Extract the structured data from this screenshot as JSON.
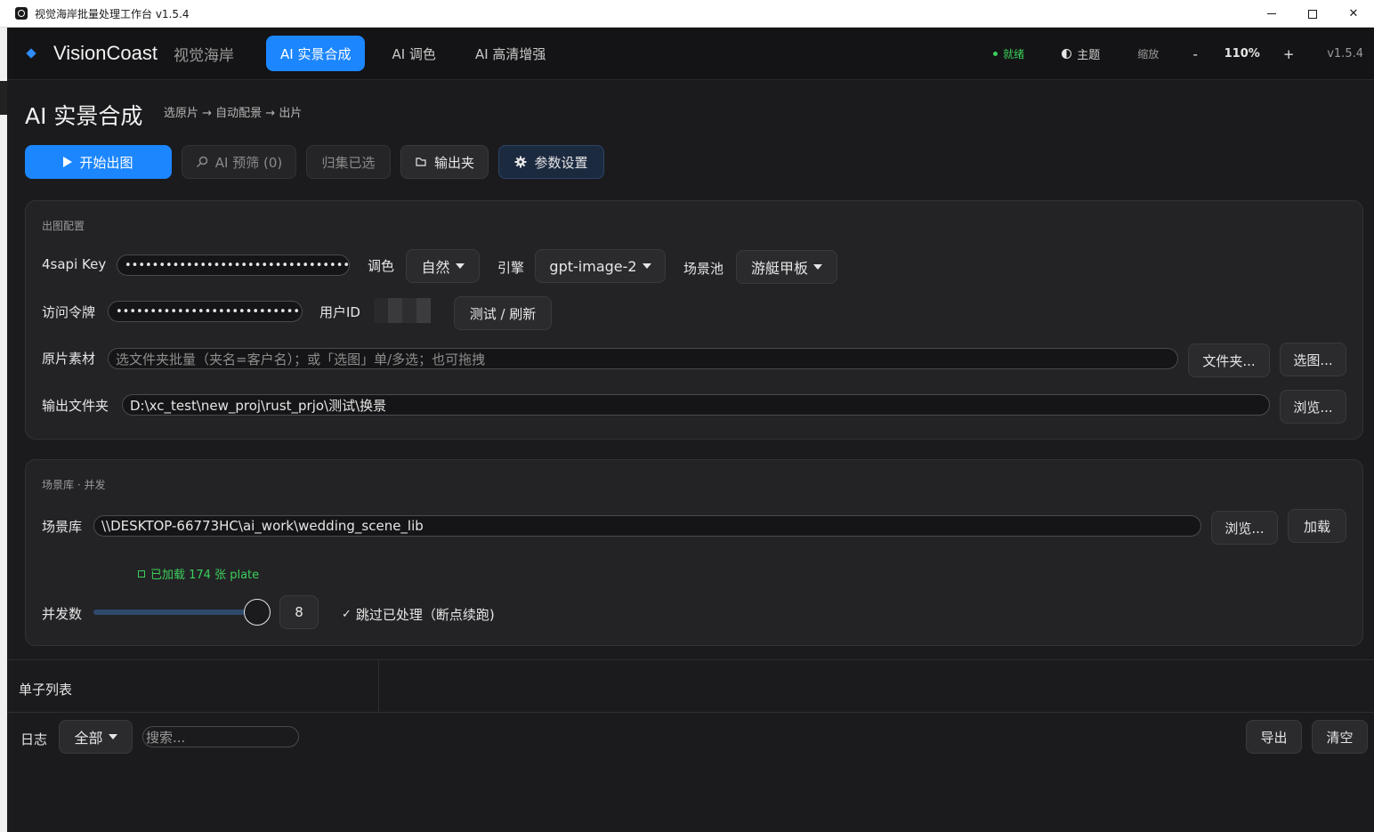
{
  "window": {
    "title": "视觉海岸批量处理工作台  v1.5.4"
  },
  "header": {
    "brand": "VisionCoast",
    "brand_cn": "视觉海岸",
    "tabs": [
      {
        "label": "AI 实景合成",
        "active": true
      },
      {
        "label": "AI 调色",
        "active": false
      },
      {
        "label": "AI 高清增强",
        "active": false
      }
    ],
    "status": "就绪",
    "theme_label": "主题",
    "zoom_label": "缩放",
    "zoom_minus": "-",
    "zoom_value": "110%",
    "zoom_plus": "+",
    "version": "v1.5.4",
    "accent_color": "#1c86ff",
    "status_color": "#3ccf5a"
  },
  "page": {
    "title": "AI 实景合成",
    "subtitle": "选原片 → 自动配景 → 出片"
  },
  "toolbar": {
    "start": "开始出图",
    "ai_filter": "AI 预筛 (0)",
    "collect": "归集已选",
    "output_folder": "输出夹",
    "settings": "参数设置"
  },
  "config": {
    "section_title": "出图配置",
    "api_key_label": "4sapi Key",
    "api_key_value": "••••••••••••••••••••••••••••••••••••••••••",
    "tone_label": "调色",
    "tone_value": "自然",
    "engine_label": "引擎",
    "engine_value": "gpt-image-2",
    "scene_pool_label": "场景池",
    "scene_pool_value": "游艇甲板",
    "token_label": "访问令牌",
    "token_value": "•••••••••••••••••••••••••••••••••••",
    "user_id_label": "用户ID",
    "test_refresh": "测试 / 刷新",
    "source_label": "原片素材",
    "source_placeholder": "选文件夹批量（夹名=客户名）；或「选图」单/多选；也可拖拽",
    "folder_button": "文件夹...",
    "pick_button": "选图...",
    "output_label": "输出文件夹",
    "output_value": "D:\\xc_test\\new_proj\\rust_prjo\\测试\\换景",
    "browse_button": "浏览..."
  },
  "scene": {
    "section_title": "场景库 · 并发",
    "lib_label": "场景库",
    "lib_value": "\\\\DESKTOP-66773HC\\ai_work\\wedding_scene_lib",
    "browse_button": "浏览...",
    "load_button": "加载",
    "loaded_text": "已加载 174 张 plate",
    "concurrency_label": "并发数",
    "concurrency_value": "8",
    "concurrency_fraction": 1.0,
    "skip_processed": "跳过已处理（断点续跑)",
    "skip_checked": true
  },
  "orders": {
    "title": "单子列表"
  },
  "log": {
    "title": "日志",
    "filter_value": "全部",
    "search_placeholder": "搜索...",
    "export": "导出",
    "clear": "清空"
  }
}
